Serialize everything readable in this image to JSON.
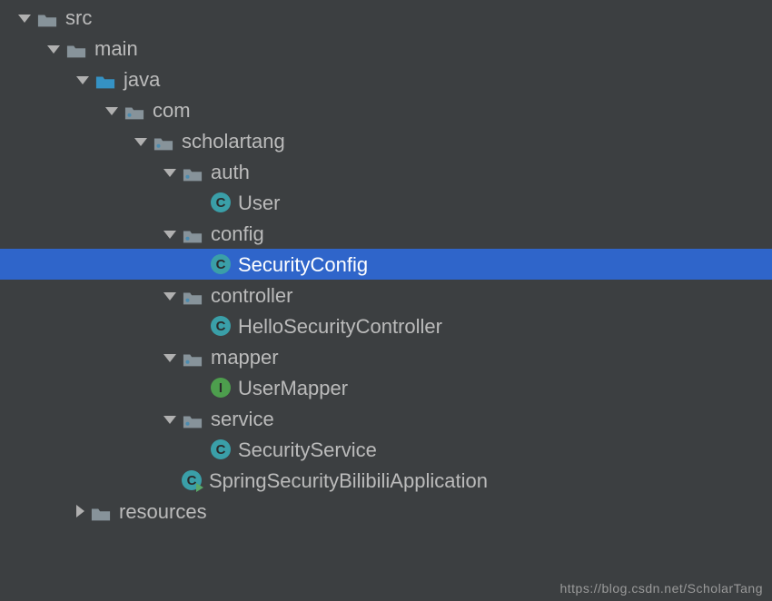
{
  "tree": [
    {
      "label": "src",
      "depth": 0,
      "icon": "folder-grey",
      "arrow": "open"
    },
    {
      "label": "main",
      "depth": 1,
      "icon": "folder-grey",
      "arrow": "open"
    },
    {
      "label": "java",
      "depth": 2,
      "icon": "folder-blue",
      "arrow": "open"
    },
    {
      "label": "com",
      "depth": 3,
      "icon": "package",
      "arrow": "open"
    },
    {
      "label": "scholartang",
      "depth": 4,
      "icon": "package",
      "arrow": "open"
    },
    {
      "label": "auth",
      "depth": 5,
      "icon": "package",
      "arrow": "open"
    },
    {
      "label": "User",
      "depth": 6,
      "icon": "class-c",
      "arrow": "none"
    },
    {
      "label": "config",
      "depth": 5,
      "icon": "package",
      "arrow": "open"
    },
    {
      "label": "SecurityConfig",
      "depth": 6,
      "icon": "class-c",
      "arrow": "none",
      "selected": true
    },
    {
      "label": "controller",
      "depth": 5,
      "icon": "package",
      "arrow": "open"
    },
    {
      "label": "HelloSecurityController",
      "depth": 6,
      "icon": "class-c",
      "arrow": "none"
    },
    {
      "label": "mapper",
      "depth": 5,
      "icon": "package",
      "arrow": "open"
    },
    {
      "label": "UserMapper",
      "depth": 6,
      "icon": "class-i",
      "arrow": "none"
    },
    {
      "label": "service",
      "depth": 5,
      "icon": "package",
      "arrow": "open"
    },
    {
      "label": "SecurityService",
      "depth": 6,
      "icon": "class-c",
      "arrow": "none"
    },
    {
      "label": "SpringSecurityBilibiliApplication",
      "depth": 5,
      "icon": "class-run",
      "arrow": "none"
    },
    {
      "label": "resources",
      "depth": 2,
      "icon": "folder-grey",
      "arrow": "closed"
    }
  ],
  "watermark": "https://blog.csdn.net/ScholarTang"
}
